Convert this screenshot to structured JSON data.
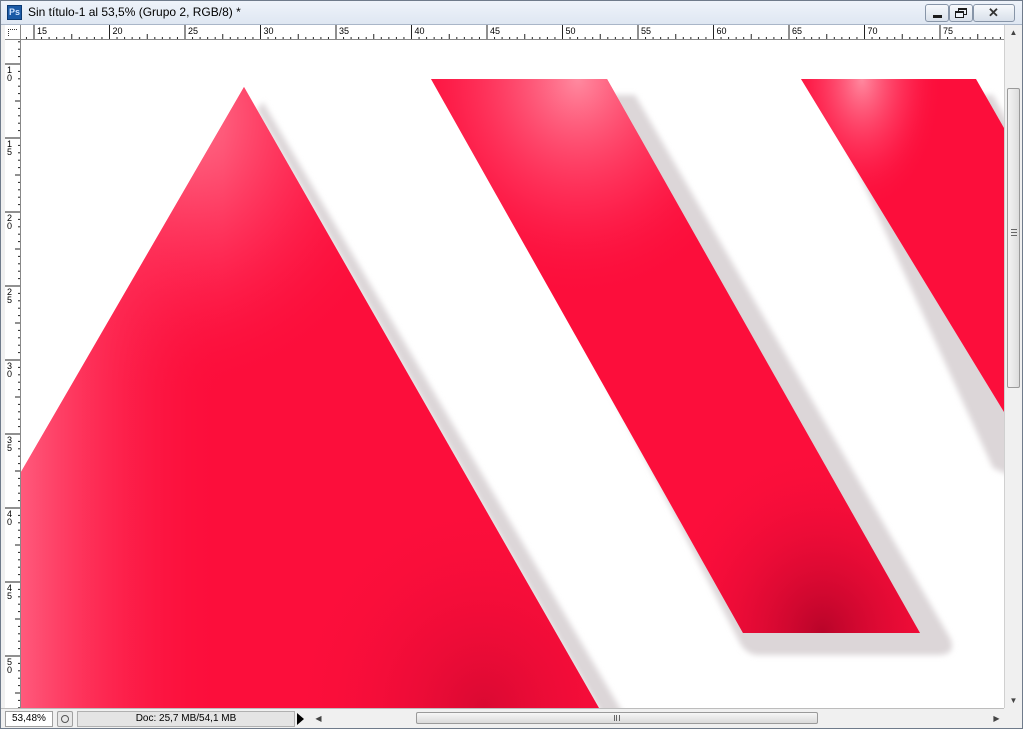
{
  "app": {
    "icon_label": "Ps",
    "window_title": "Sin título-1 al 53,5% (Grupo 2, RGB/8) *"
  },
  "window_controls": {
    "close_glyph": "✕"
  },
  "rulers": {
    "horizontal_ticks": [
      "15",
      "20",
      "25",
      "30",
      "35",
      "40",
      "45",
      "50",
      "55",
      "60",
      "65",
      "70",
      "75"
    ],
    "vertical_ticks": [
      "10",
      "15",
      "20",
      "25",
      "30",
      "35",
      "40",
      "45",
      "50"
    ]
  },
  "status": {
    "zoom": "53,48%",
    "doc_size": "Doc: 25,7 MB/54,1 MB"
  },
  "colors": {
    "shape_red": "#fc0e3b",
    "shape_highlight": "#ff6a86",
    "shape_dark": "#c7062c",
    "shadow": "#dcd6d8"
  },
  "icons": {
    "vertical_up": "scroll-up-arrow-icon",
    "vertical_down": "scroll-down-arrow-icon",
    "horizontal_left": "scroll-left-arrow-icon",
    "horizontal_right": "scroll-right-arrow-icon"
  }
}
